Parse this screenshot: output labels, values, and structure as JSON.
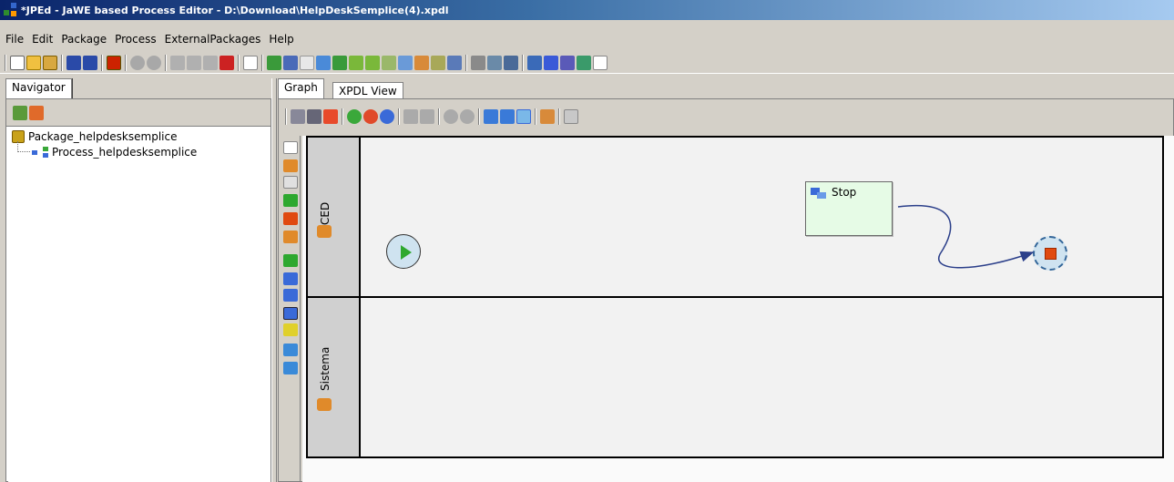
{
  "window": {
    "title": "*JPEd - JaWE based Process Editor - D:\\Download\\HelpDeskSemplice(4).xpdl"
  },
  "menu": {
    "items": [
      "File",
      "Edit",
      "Package",
      "Process",
      "ExternalPackages",
      "Help"
    ]
  },
  "navigator": {
    "tab_label": "Navigator",
    "tree": {
      "package": "Package_helpdesksemplice",
      "process": "Process_helpdesksemplice"
    }
  },
  "editor": {
    "tabs": [
      "Graph",
      "XPDL View"
    ],
    "active_tab": "Graph"
  },
  "graph": {
    "lanes": [
      {
        "name": "CED"
      },
      {
        "name": "Sistema"
      }
    ],
    "activity": {
      "label": "Stop"
    }
  },
  "colors": {
    "activity_fill": "#e6fbe6",
    "event_fill": "#cfe3f0",
    "start_arrow": "#2ea82e",
    "end_marker": "#e04a10",
    "transition": "#2b3f8a"
  }
}
